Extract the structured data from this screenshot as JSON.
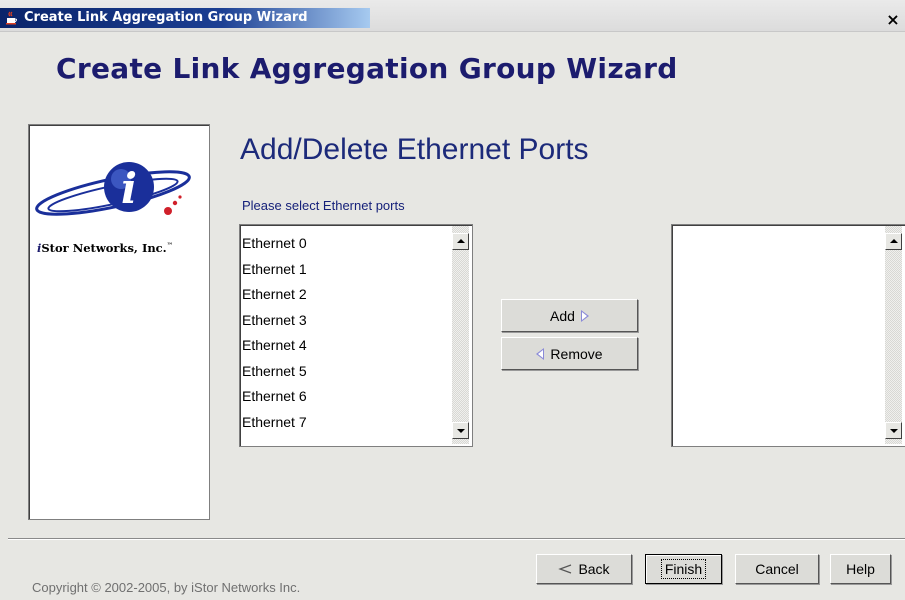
{
  "window": {
    "title": "Create Link Aggregation Group Wizard",
    "close_symbol": "×"
  },
  "banner": {
    "title": "Create Link Aggregation Group Wizard"
  },
  "logo": {
    "company_name": "Stor Networks, Inc.",
    "company_prefix": "i",
    "trademark": "™"
  },
  "page": {
    "title": "Add/Delete Ethernet Ports",
    "instruction": "Please select Ethernet ports"
  },
  "available_ports": {
    "items": [
      "Ethernet 0",
      "Ethernet 1",
      "Ethernet 2",
      "Ethernet 3",
      "Ethernet 4",
      "Ethernet 5",
      "Ethernet 6",
      "Ethernet 7"
    ]
  },
  "selected_ports": {
    "items": []
  },
  "transfer": {
    "add_label": "Add",
    "remove_label": "Remove"
  },
  "footer": {
    "copyright": "Copyright © 2002-2005, by iStor Networks Inc.",
    "back_label": "Back",
    "finish_label": "Finish",
    "cancel_label": "Cancel",
    "help_label": "Help"
  },
  "colors": {
    "title_bar": "#0a246a",
    "banner_text": "#1c1c6e",
    "heading_text": "#1c2a7a",
    "logo_sphere": "#1a2f9a",
    "logo_dots": "#d0202a",
    "arrow_icon": "#8a8ad8"
  },
  "icons": {
    "window_icon": "java-cup-icon",
    "close": "close-icon",
    "add_arrow": "triangle-right-icon",
    "remove_arrow": "triangle-left-icon",
    "back_arrow": "back-arrow-icon",
    "scroll_up": "scroll-up-icon",
    "scroll_down": "scroll-down-icon"
  }
}
